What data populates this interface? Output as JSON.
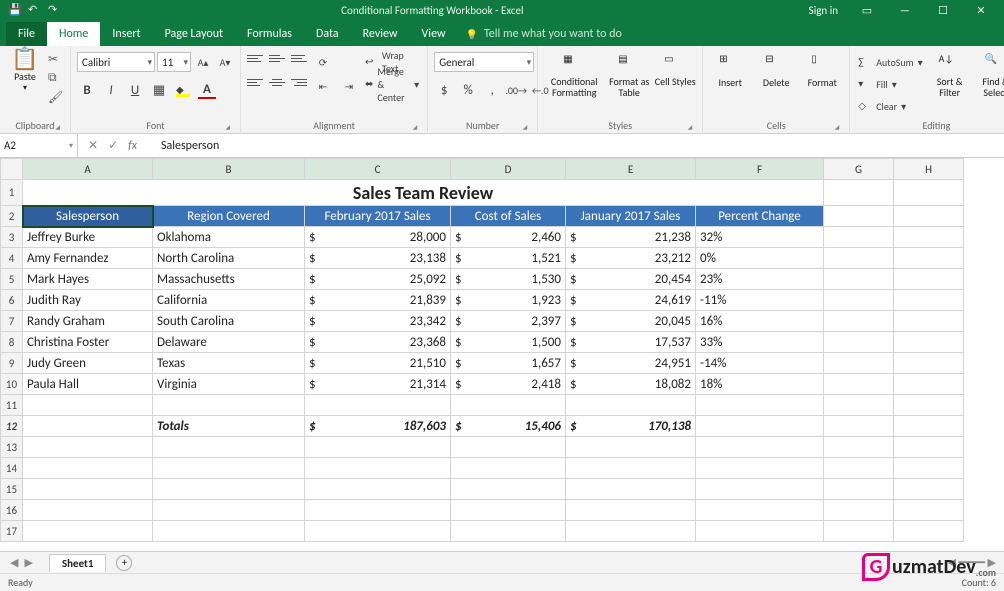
{
  "title": "Conditional Formatting Workbook - Excel",
  "signin": "Sign in",
  "tabs": {
    "file": "File",
    "home": "Home",
    "insert": "Insert",
    "pagelayout": "Page Layout",
    "formulas": "Formulas",
    "data": "Data",
    "review": "Review",
    "view": "View"
  },
  "tellme": "Tell me what you want to do",
  "ribbon": {
    "paste": "Paste",
    "font_name": "Calibri",
    "font_size": "11",
    "wrap": "Wrap Text",
    "merge": "Merge & Center",
    "num_format": "General",
    "cond": "Conditional Formatting",
    "fmt_table": "Format as Table",
    "cell_styles": "Cell Styles",
    "insert": "Insert",
    "delete": "Delete",
    "format": "Format",
    "autosum": "AutoSum",
    "fill": "Fill",
    "clear": "Clear",
    "sortfilter": "Sort & Filter",
    "findselect": "Find & Select",
    "g_clip": "Clipboard",
    "g_font": "Font",
    "g_align": "Alignment",
    "g_num": "Number",
    "g_styles": "Styles",
    "g_cells": "Cells",
    "g_edit": "Editing"
  },
  "namebox": "A2",
  "formula": "Salesperson",
  "columns": [
    "A",
    "B",
    "C",
    "D",
    "E",
    "F",
    "G",
    "H"
  ],
  "row_title": "Sales Team Review",
  "headers": [
    "Salesperson",
    "Region Covered",
    "February 2017 Sales",
    "Cost of Sales",
    "January 2017 Sales",
    "Percent Change"
  ],
  "rows": [
    {
      "n": 3,
      "name": "Jeffrey Burke",
      "region": "Oklahoma",
      "feb": "28,000",
      "cost": "2,460",
      "jan": "21,238",
      "pct": "32%"
    },
    {
      "n": 4,
      "name": "Amy Fernandez",
      "region": "North Carolina",
      "feb": "23,138",
      "cost": "1,521",
      "jan": "23,212",
      "pct": "0%"
    },
    {
      "n": 5,
      "name": "Mark Hayes",
      "region": "Massachusetts",
      "feb": "25,092",
      "cost": "1,530",
      "jan": "20,454",
      "pct": "23%"
    },
    {
      "n": 6,
      "name": "Judith Ray",
      "region": "California",
      "feb": "21,839",
      "cost": "1,923",
      "jan": "24,619",
      "pct": "-11%"
    },
    {
      "n": 7,
      "name": "Randy Graham",
      "region": "South Carolina",
      "feb": "23,342",
      "cost": "2,397",
      "jan": "20,045",
      "pct": "16%"
    },
    {
      "n": 8,
      "name": "Christina Foster",
      "region": "Delaware",
      "feb": "23,368",
      "cost": "1,500",
      "jan": "17,537",
      "pct": "33%"
    },
    {
      "n": 9,
      "name": "Judy Green",
      "region": "Texas",
      "feb": "21,510",
      "cost": "1,657",
      "jan": "24,951",
      "pct": "-14%"
    },
    {
      "n": 10,
      "name": "Paula Hall",
      "region": "Virginia",
      "feb": "21,314",
      "cost": "2,418",
      "jan": "18,082",
      "pct": "18%"
    }
  ],
  "totals": {
    "label": "Totals",
    "feb": "187,603",
    "cost": "15,406",
    "jan": "170,138"
  },
  "sheet_tab": "Sheet1",
  "status_ready": "Ready",
  "status_count": "Count: 6",
  "watermark": {
    "g": "G",
    "rest": "uzmatDev",
    "com": ".com"
  },
  "chart_data": {
    "type": "table",
    "title": "Sales Team Review",
    "columns": [
      "Salesperson",
      "Region Covered",
      "February 2017 Sales",
      "Cost of Sales",
      "January 2017 Sales",
      "Percent Change"
    ],
    "data": [
      [
        "Jeffrey Burke",
        "Oklahoma",
        28000,
        2460,
        21238,
        "32%"
      ],
      [
        "Amy Fernandez",
        "North Carolina",
        23138,
        1521,
        23212,
        "0%"
      ],
      [
        "Mark Hayes",
        "Massachusetts",
        25092,
        1530,
        20454,
        "23%"
      ],
      [
        "Judith Ray",
        "California",
        21839,
        1923,
        24619,
        "-11%"
      ],
      [
        "Randy Graham",
        "South Carolina",
        23342,
        2397,
        20045,
        "16%"
      ],
      [
        "Christina Foster",
        "Delaware",
        23368,
        1500,
        17537,
        "33%"
      ],
      [
        "Judy Green",
        "Texas",
        21510,
        1657,
        24951,
        "-14%"
      ],
      [
        "Paula Hall",
        "Virginia",
        21314,
        2418,
        18082,
        "18%"
      ]
    ],
    "totals": {
      "February 2017 Sales": 187603,
      "Cost of Sales": 15406,
      "January 2017 Sales": 170138
    }
  }
}
